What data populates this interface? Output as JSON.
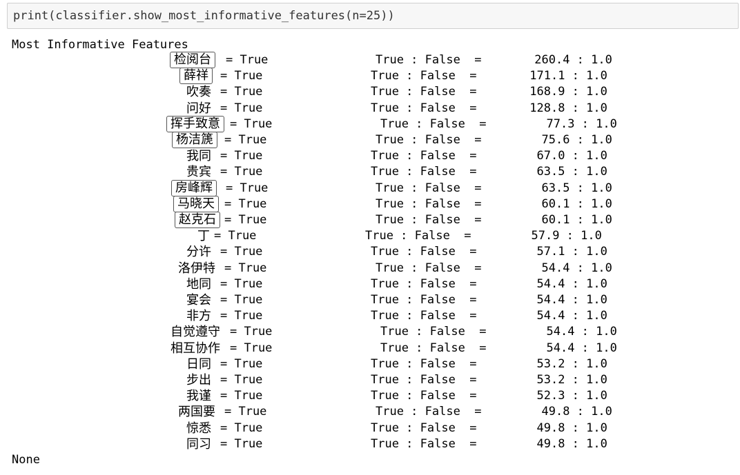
{
  "code_cell": {
    "source": "print(classifier.show_most_informative_features(n=25))"
  },
  "output": {
    "title": "Most Informative Features",
    "features": [
      {
        "name": "检阅台",
        "value": "True",
        "ratio_label": "True : False",
        "ratio": "260.4 : 1.0"
      },
      {
        "name": "薛祥",
        "value": "True",
        "ratio_label": "True : False",
        "ratio": "171.1 : 1.0"
      },
      {
        "name": "吹奏",
        "value": "True",
        "ratio_label": "True : False",
        "ratio": "168.9 : 1.0"
      },
      {
        "name": "问好",
        "value": "True",
        "ratio_label": "True : False",
        "ratio": "128.8 : 1.0"
      },
      {
        "name": "挥手致意",
        "value": "True",
        "ratio_label": "True : False",
        "ratio": "77.3 : 1.0"
      },
      {
        "name": "杨洁篪",
        "value": "True",
        "ratio_label": "True : False",
        "ratio": "75.6 : 1.0"
      },
      {
        "name": "我同",
        "value": "True",
        "ratio_label": "True : False",
        "ratio": "67.0 : 1.0"
      },
      {
        "name": "贵宾",
        "value": "True",
        "ratio_label": "True : False",
        "ratio": "63.5 : 1.0"
      },
      {
        "name": "房峰辉",
        "value": "True",
        "ratio_label": "True : False",
        "ratio": "63.5 : 1.0"
      },
      {
        "name": "马晓天",
        "value": "True",
        "ratio_label": "True : False",
        "ratio": "60.1 : 1.0"
      },
      {
        "name": "赵克石",
        "value": "True",
        "ratio_label": "True : False",
        "ratio": "60.1 : 1.0"
      },
      {
        "name": "丁",
        "value": "True",
        "ratio_label": "True : False",
        "ratio": "57.9 : 1.0"
      },
      {
        "name": "分许",
        "value": "True",
        "ratio_label": "True : False",
        "ratio": "57.1 : 1.0"
      },
      {
        "name": "洛伊特",
        "value": "True",
        "ratio_label": "True : False",
        "ratio": "54.4 : 1.0"
      },
      {
        "name": "地同",
        "value": "True",
        "ratio_label": "True : False",
        "ratio": "54.4 : 1.0"
      },
      {
        "name": "宴会",
        "value": "True",
        "ratio_label": "True : False",
        "ratio": "54.4 : 1.0"
      },
      {
        "name": "非方",
        "value": "True",
        "ratio_label": "True : False",
        "ratio": "54.4 : 1.0"
      },
      {
        "name": "自觉遵守",
        "value": "True",
        "ratio_label": "True : False",
        "ratio": "54.4 : 1.0"
      },
      {
        "name": "相互协作",
        "value": "True",
        "ratio_label": "True : False",
        "ratio": "54.4 : 1.0"
      },
      {
        "name": "日同",
        "value": "True",
        "ratio_label": "True : False",
        "ratio": "53.2 : 1.0"
      },
      {
        "name": "步出",
        "value": "True",
        "ratio_label": "True : False",
        "ratio": "53.2 : 1.0"
      },
      {
        "name": "我谨",
        "value": "True",
        "ratio_label": "True : False",
        "ratio": "52.3 : 1.0"
      },
      {
        "name": "两国要",
        "value": "True",
        "ratio_label": "True : False",
        "ratio": "49.8 : 1.0"
      },
      {
        "name": "惊悉",
        "value": "True",
        "ratio_label": "True : False",
        "ratio": "49.8 : 1.0"
      },
      {
        "name": "同习",
        "value": "True",
        "ratio_label": "True : False",
        "ratio": "49.8 : 1.0"
      }
    ],
    "footer": "None"
  }
}
